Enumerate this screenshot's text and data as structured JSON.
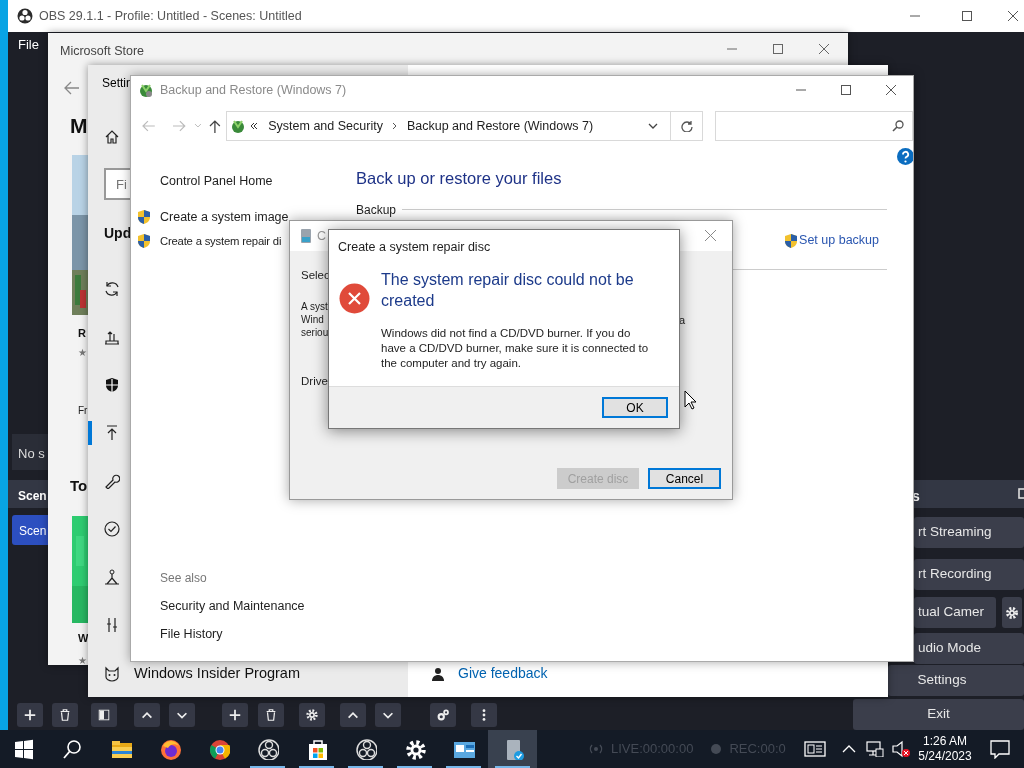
{
  "obs": {
    "title": "OBS 29.1.1 - Profile: Untitled - Scenes: Untitled",
    "menu": [
      "File"
    ],
    "sources_hint": "No s",
    "scenes_title": "Scen",
    "scenes": [
      {
        "label": "Scen",
        "selected": true
      }
    ],
    "controls_title": "s",
    "controls": [
      {
        "label": "rt Streaming",
        "kind": "button"
      },
      {
        "label": "rt Recording",
        "kind": "button"
      },
      {
        "label": "tual Camer",
        "kind": "split"
      },
      {
        "label": "udio Mode",
        "kind": "button"
      },
      {
        "label": "Settings",
        "kind": "button"
      },
      {
        "label": "Exit",
        "kind": "button"
      }
    ],
    "status": {
      "live": "LIVE:00:00:00",
      "rec": "REC:00:0"
    }
  },
  "store": {
    "title": "Microsoft Store",
    "sections": [
      {
        "heading": "M",
        "apps": [
          {
            "title": "R",
            "rating": "★",
            "price": "Fr"
          }
        ]
      },
      {
        "heading": "To",
        "apps": [
          {
            "title": "W",
            "rating": "★"
          }
        ]
      }
    ]
  },
  "settings": {
    "title": "Settin",
    "search_placeholder": "Fi",
    "group": "Upd",
    "nav": [
      {
        "selected": false
      },
      {
        "selected": false
      },
      {
        "selected": false
      },
      {
        "selected": true
      },
      {
        "selected": false
      },
      {
        "selected": false
      },
      {
        "selected": false
      },
      {
        "selected": false
      },
      {
        "selected": false,
        "label": "Windows Insider Program"
      }
    ],
    "feedback": "Give feedback"
  },
  "backup": {
    "title": "Backup and Restore (Windows 7)",
    "breadcrumb": [
      "System and Security",
      "Backup and Restore (Windows 7)"
    ],
    "tasks": [
      {
        "label": "Control Panel Home",
        "shield": false
      },
      {
        "label": "Create a system image",
        "shield": true
      },
      {
        "label": "Create a system repair di",
        "shield": true
      }
    ],
    "see_also_title": "See also",
    "see_also": [
      "Security and Maintenance",
      "File History"
    ],
    "heading": "Back up or restore your files",
    "section": "Backup",
    "action": "Set up backup"
  },
  "disc_dialog": {
    "title": "C",
    "intro": "Selec",
    "description": [
      "A syst",
      "Wind",
      "seriou"
    ],
    "fragment": "a",
    "drive_label": "Drive",
    "buttons": [
      {
        "label": "Create disc",
        "disabled": true,
        "default": false
      },
      {
        "label": "Cancel",
        "disabled": false,
        "default": true
      }
    ]
  },
  "message": {
    "title": "Create a system repair disc",
    "heading": "The system repair disc could not be created",
    "body": "Windows did not find a CD/DVD burner. If you do have a CD/DVD burner, make sure it is connected to the computer and try again.",
    "button": "OK"
  },
  "taskbar": {
    "apps": [
      {
        "running": false,
        "selected": false
      },
      {
        "running": false,
        "selected": false
      },
      {
        "running": false,
        "selected": false
      },
      {
        "running": true,
        "selected": false
      },
      {
        "running": true,
        "selected": false
      },
      {
        "running": true,
        "selected": false
      },
      {
        "running": true,
        "selected": false
      },
      {
        "running": true,
        "selected": false
      },
      {
        "running": true,
        "selected": true
      }
    ],
    "time": "1:26 AM",
    "date": "5/24/2023"
  }
}
